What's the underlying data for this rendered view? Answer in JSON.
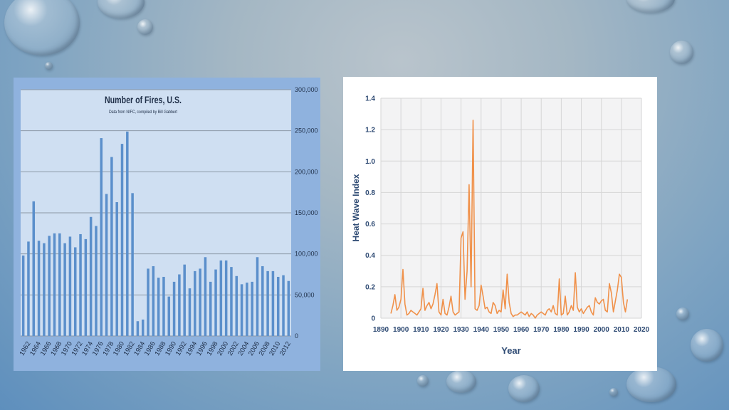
{
  "colors": {
    "fires_panel_bg": "#8fb2de",
    "fires_plot_bg": "#cfdff2",
    "fires_bar": "#5b8fcb",
    "heat_line": "#f0914a",
    "heat_grid": "#d6d6d6",
    "heat_plot_bg": "#f3f3f4",
    "axis_text": "#2e4a73"
  },
  "chart_data": [
    {
      "type": "bar",
      "title": "Number of Fires, U.S.",
      "subtitle": "Data from NIFC, compiled by Bill Gabbert",
      "xlabel": "",
      "ylabel": "",
      "ylim": [
        0,
        300000
      ],
      "y_ticks": [
        "0",
        "50,000",
        "100,000",
        "150,000",
        "200,000",
        "250,000",
        "300,000"
      ],
      "y_axis_side": "right",
      "grid": true,
      "x_tick_labels": [
        "1962",
        "1964",
        "1966",
        "1968",
        "1970",
        "1972",
        "1974",
        "1976",
        "1978",
        "1980",
        "1982",
        "1984",
        "1986",
        "1988",
        "1990",
        "1992",
        "1994",
        "1996",
        "1998",
        "2000",
        "2002",
        "2004",
        "2006",
        "2008",
        "2010",
        "2012"
      ],
      "categories": [
        1961,
        1962,
        1963,
        1964,
        1965,
        1966,
        1967,
        1968,
        1969,
        1970,
        1971,
        1972,
        1973,
        1974,
        1975,
        1976,
        1977,
        1978,
        1979,
        1980,
        1981,
        1982,
        1983,
        1984,
        1985,
        1986,
        1987,
        1988,
        1989,
        1990,
        1991,
        1992,
        1993,
        1994,
        1995,
        1996,
        1997,
        1998,
        1999,
        2000,
        2001,
        2002,
        2003,
        2004,
        2005,
        2006,
        2007,
        2008,
        2009,
        2010,
        2011,
        2012
      ],
      "values": [
        98000,
        115000,
        164000,
        116000,
        113000,
        122000,
        125000,
        125000,
        113000,
        121000,
        108000,
        124000,
        118000,
        145000,
        134000,
        241000,
        173000,
        218000,
        163000,
        234000,
        249000,
        174000,
        18000,
        20000,
        82000,
        85000,
        71000,
        72000,
        48000,
        66000,
        75000,
        87000,
        58000,
        79000,
        82000,
        96000,
        66000,
        81000,
        92000,
        92000,
        84000,
        73000,
        63000,
        65000,
        66000,
        96000,
        85000,
        79000,
        79000,
        72000,
        74000,
        67000
      ]
    },
    {
      "type": "line",
      "title": "",
      "xlabel": "Year",
      "ylabel": "Heat Wave Index",
      "xlim": [
        1890,
        2020
      ],
      "ylim": [
        0,
        1.4
      ],
      "x_ticks": [
        1890,
        1900,
        1910,
        1920,
        1930,
        1940,
        1950,
        1960,
        1970,
        1980,
        1990,
        2000,
        2010,
        2020
      ],
      "y_ticks": [
        "0",
        "0.2",
        "0.4",
        "0.6",
        "0.8",
        "1.0",
        "1.2",
        "1.4"
      ],
      "grid": true,
      "legend": "none",
      "x": [
        1895,
        1896,
        1897,
        1898,
        1899,
        1900,
        1901,
        1902,
        1903,
        1904,
        1905,
        1906,
        1907,
        1908,
        1909,
        1910,
        1911,
        1912,
        1913,
        1914,
        1915,
        1916,
        1917,
        1918,
        1919,
        1920,
        1921,
        1922,
        1923,
        1924,
        1925,
        1926,
        1927,
        1928,
        1929,
        1930,
        1931,
        1932,
        1933,
        1934,
        1935,
        1936,
        1937,
        1938,
        1939,
        1940,
        1941,
        1942,
        1943,
        1944,
        1945,
        1946,
        1947,
        1948,
        1949,
        1950,
        1951,
        1952,
        1953,
        1954,
        1955,
        1956,
        1957,
        1958,
        1959,
        1960,
        1961,
        1962,
        1963,
        1964,
        1965,
        1966,
        1967,
        1968,
        1969,
        1970,
        1971,
        1972,
        1973,
        1974,
        1975,
        1976,
        1977,
        1978,
        1979,
        1980,
        1981,
        1982,
        1983,
        1984,
        1985,
        1986,
        1987,
        1988,
        1989,
        1990,
        1991,
        1992,
        1993,
        1994,
        1995,
        1996,
        1997,
        1998,
        1999,
        2000,
        2001,
        2002,
        2003,
        2004,
        2005,
        2006,
        2007,
        2008,
        2009,
        2010,
        2011,
        2012,
        2013,
        2014,
        2015
      ],
      "y": [
        0.03,
        0.08,
        0.15,
        0.05,
        0.07,
        0.12,
        0.31,
        0.09,
        0.02,
        0.03,
        0.05,
        0.04,
        0.03,
        0.02,
        0.04,
        0.06,
        0.19,
        0.05,
        0.08,
        0.1,
        0.06,
        0.09,
        0.15,
        0.22,
        0.04,
        0.02,
        0.12,
        0.03,
        0.02,
        0.07,
        0.14,
        0.04,
        0.02,
        0.03,
        0.04,
        0.51,
        0.55,
        0.12,
        0.3,
        0.85,
        0.2,
        1.26,
        0.06,
        0.05,
        0.08,
        0.21,
        0.14,
        0.06,
        0.07,
        0.04,
        0.03,
        0.1,
        0.08,
        0.03,
        0.05,
        0.04,
        0.18,
        0.06,
        0.28,
        0.1,
        0.03,
        0.01,
        0.02,
        0.02,
        0.03,
        0.04,
        0.03,
        0.02,
        0.04,
        0.01,
        0.03,
        0.02,
        0.0,
        0.02,
        0.03,
        0.04,
        0.03,
        0.02,
        0.05,
        0.06,
        0.04,
        0.08,
        0.03,
        0.02,
        0.25,
        0.02,
        0.03,
        0.14,
        0.02,
        0.04,
        0.08,
        0.05,
        0.29,
        0.07,
        0.04,
        0.06,
        0.03,
        0.05,
        0.07,
        0.08,
        0.04,
        0.02,
        0.13,
        0.1,
        0.09,
        0.11,
        0.12,
        0.05,
        0.04,
        0.22,
        0.16,
        0.04,
        0.11,
        0.18,
        0.28,
        0.26,
        0.1,
        0.04,
        0.12
      ]
    }
  ]
}
